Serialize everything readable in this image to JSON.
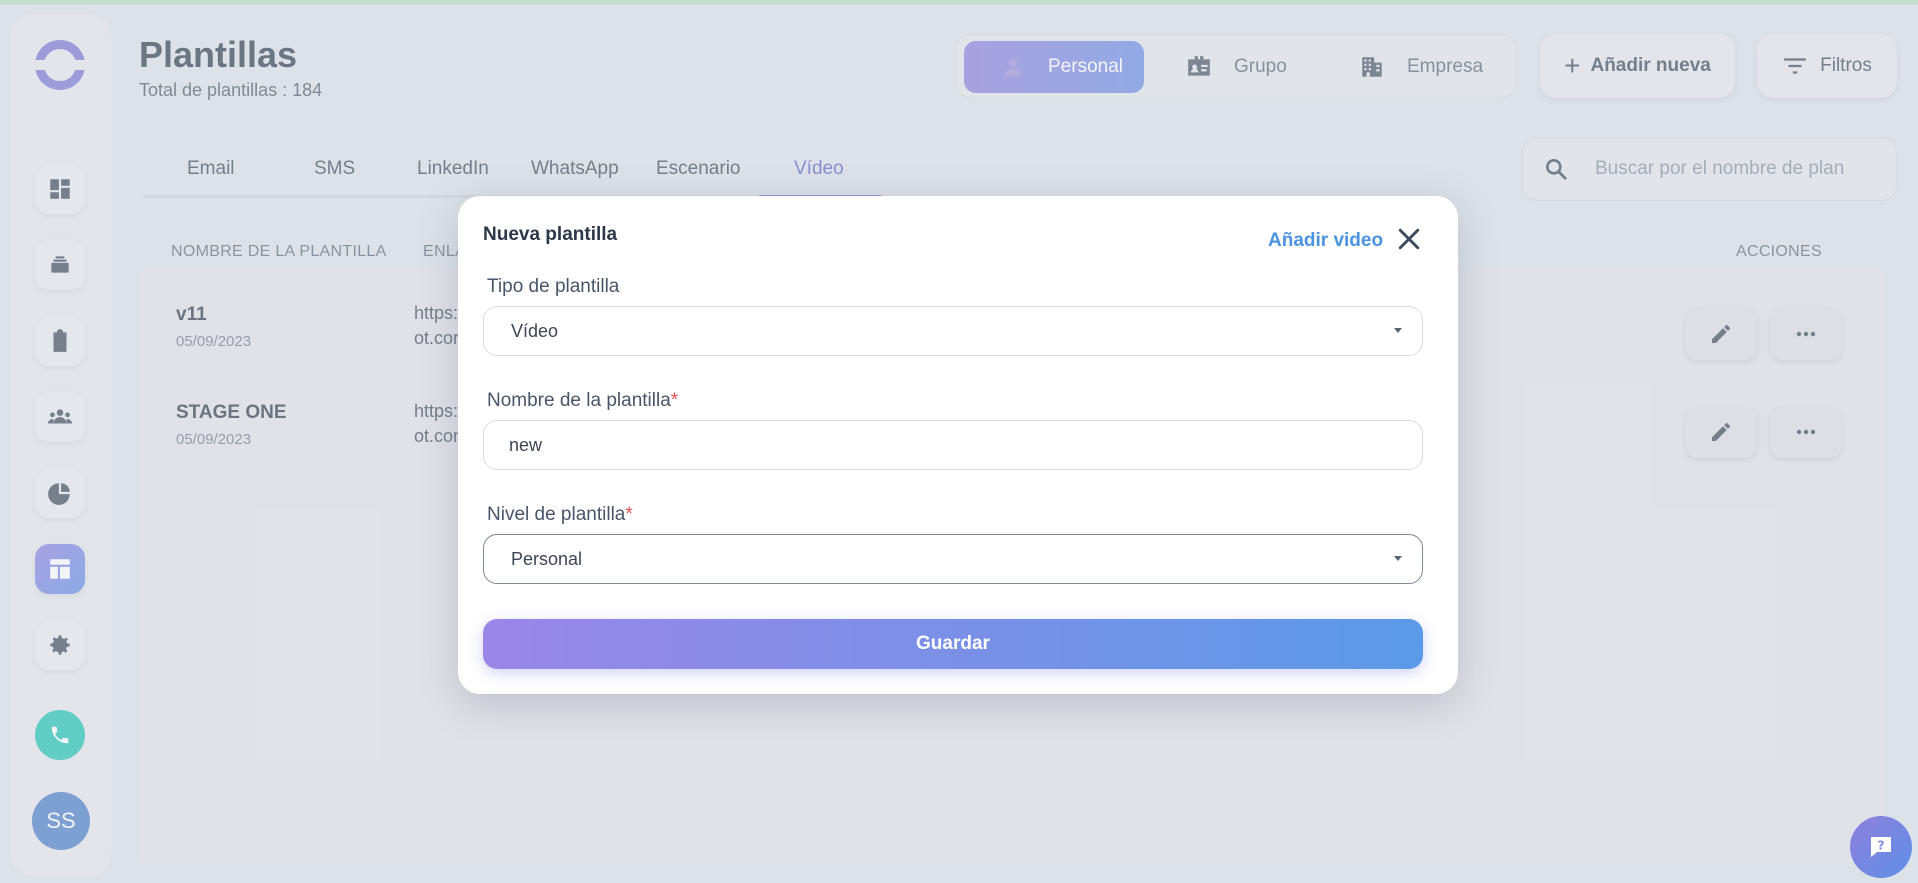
{
  "header": {
    "title": "Plantillas",
    "subtitle": "Total de plantillas : 184"
  },
  "level_toggle": {
    "options": [
      {
        "label": "Personal",
        "icon": "person-icon",
        "active": true
      },
      {
        "label": "Grupo",
        "icon": "id-card-icon",
        "active": false
      },
      {
        "label": "Empresa",
        "icon": "building-icon",
        "active": false
      }
    ]
  },
  "actions": {
    "add_label": "Añadir nueva",
    "filter_label": "Filtros"
  },
  "tabs": [
    {
      "label": "Email",
      "active": false
    },
    {
      "label": "SMS",
      "active": false
    },
    {
      "label": "LinkedIn",
      "active": false
    },
    {
      "label": "WhatsApp",
      "active": false
    },
    {
      "label": "Escenario",
      "active": false
    },
    {
      "label": "Vídeo",
      "active": true
    }
  ],
  "search": {
    "placeholder": "Buscar por el nombre de plan"
  },
  "table": {
    "columns": [
      "NOMBRE DE LA PLANTILLA",
      "ENLA",
      "ACCIONES"
    ],
    "rows": [
      {
        "name": "v11",
        "date": "05/09/2023",
        "link_line1": "https:",
        "link_line2": "ot.cor"
      },
      {
        "name": "STAGE ONE",
        "date": "05/09/2023",
        "link_line1": "https:",
        "link_line2": "ot.con"
      }
    ]
  },
  "sidebar": {
    "items": [
      "dashboard-icon",
      "layers-icon",
      "clipboard-icon",
      "users-icon",
      "chart-icon",
      "templates-icon",
      "settings-icon"
    ],
    "active_item": "templates-icon",
    "avatar_initials": "SS"
  },
  "modal": {
    "title": "Nueva plantilla",
    "add_video_label": "Añadir video",
    "type_label": "Tipo de plantilla",
    "type_value": "Vídeo",
    "name_label": "Nombre de la plantilla",
    "name_value": "new",
    "level_label": "Nivel de plantilla",
    "level_value": "Personal",
    "required_mark": "*",
    "save_label": "Guardar"
  },
  "colors": {
    "accent_start": "#8e7fde",
    "accent_end": "#5b9ae8",
    "link_blue": "#4c93e0",
    "required_red": "#e05252",
    "phone_teal": "#1fc3b4"
  }
}
